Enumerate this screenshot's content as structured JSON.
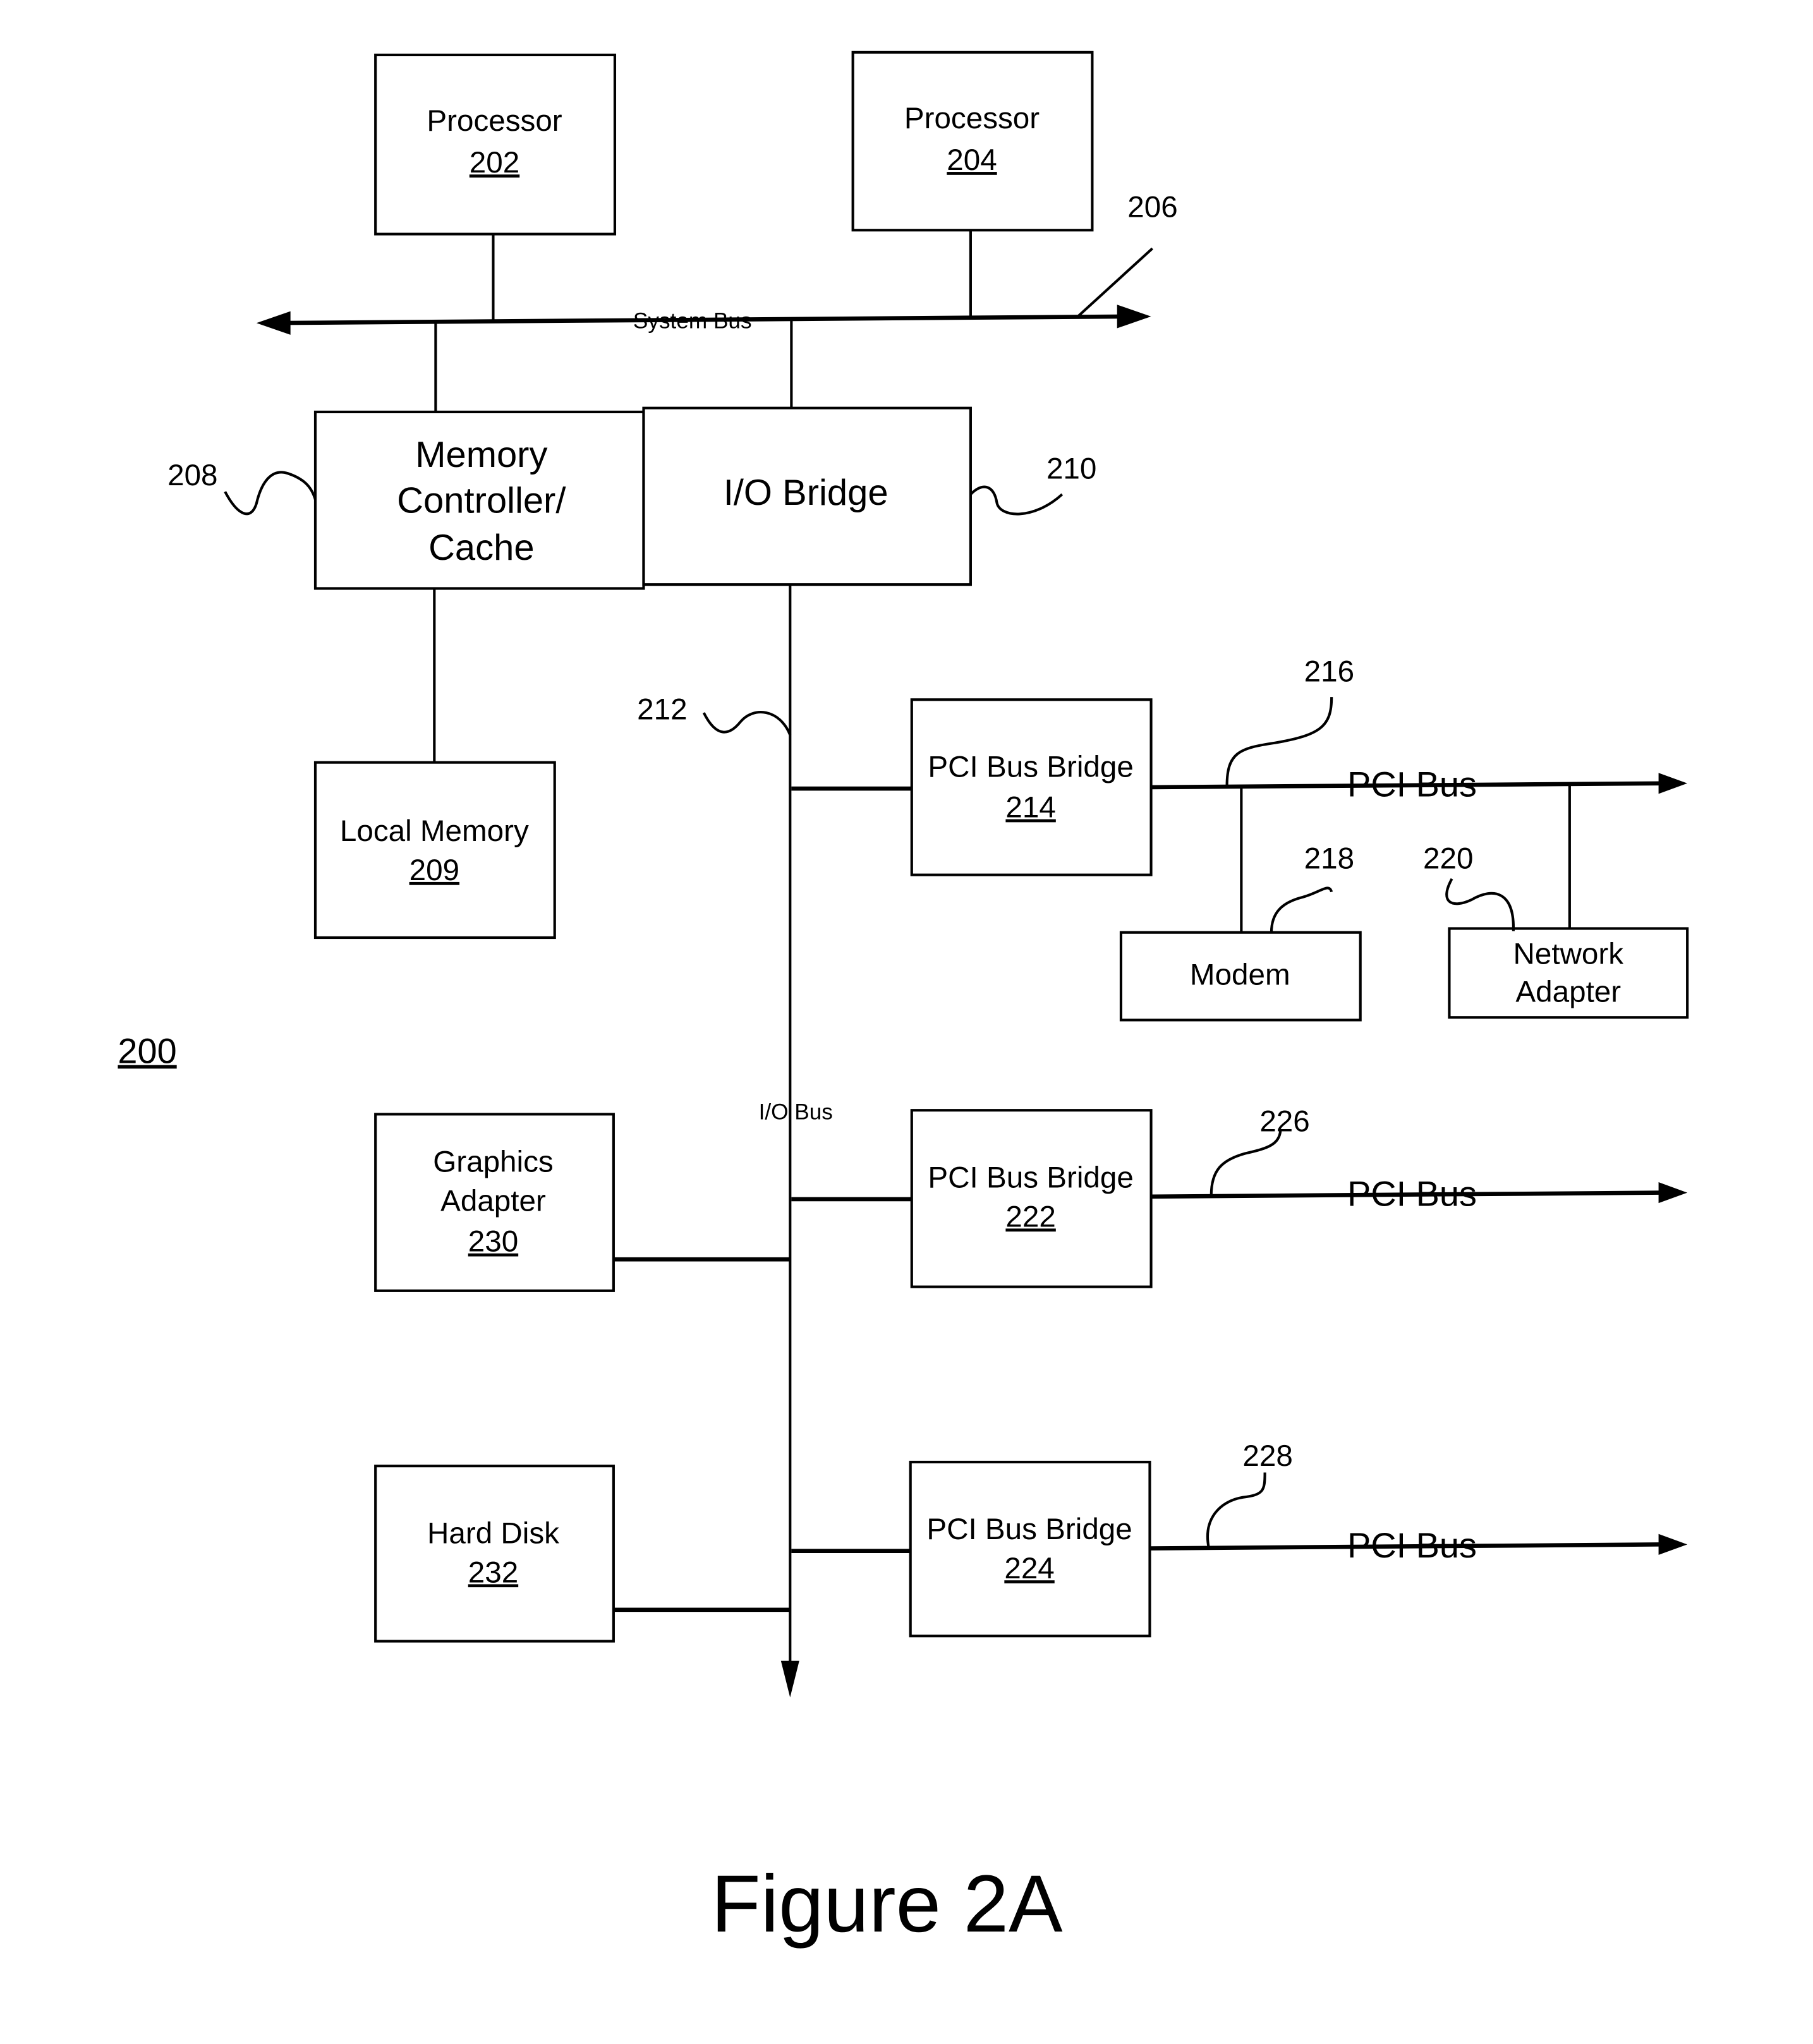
{
  "figure": {
    "caption": "Figure 2A",
    "reference_number": "200"
  },
  "buses": {
    "system_bus": {
      "label": "System Bus",
      "ref": "206"
    },
    "io_bus": {
      "label": "I/O Bus",
      "ref": "212"
    },
    "pci_bus_1": {
      "label": "PCI Bus",
      "ref": "216"
    },
    "pci_bus_2": {
      "label": "PCI Bus",
      "ref": "226"
    },
    "pci_bus_3": {
      "label": "PCI Bus",
      "ref": "228"
    }
  },
  "components": {
    "processor_1": {
      "label": "Processor",
      "num": "202"
    },
    "processor_2": {
      "label": "Processor",
      "num": "204"
    },
    "memory_controller": {
      "lines": [
        "Memory",
        "Controller/",
        "Cache"
      ],
      "ref": "208"
    },
    "io_bridge": {
      "label": "I/O Bridge",
      "ref": "210"
    },
    "local_memory": {
      "label": "Local Memory",
      "num": "209"
    },
    "pci_bridge_1": {
      "label": "PCI Bus Bridge",
      "num": "214"
    },
    "pci_bridge_2": {
      "label": "PCI Bus Bridge",
      "num": "222"
    },
    "pci_bridge_3": {
      "label": "PCI Bus Bridge",
      "num": "224"
    },
    "modem": {
      "label": "Modem",
      "ref": "218"
    },
    "network_adapter": {
      "lines": [
        "Network",
        "Adapter"
      ],
      "ref": "220"
    },
    "graphics_adapter": {
      "lines": [
        "Graphics",
        "Adapter"
      ],
      "num": "230"
    },
    "hard_disk": {
      "label": "Hard Disk",
      "num": "232"
    }
  }
}
